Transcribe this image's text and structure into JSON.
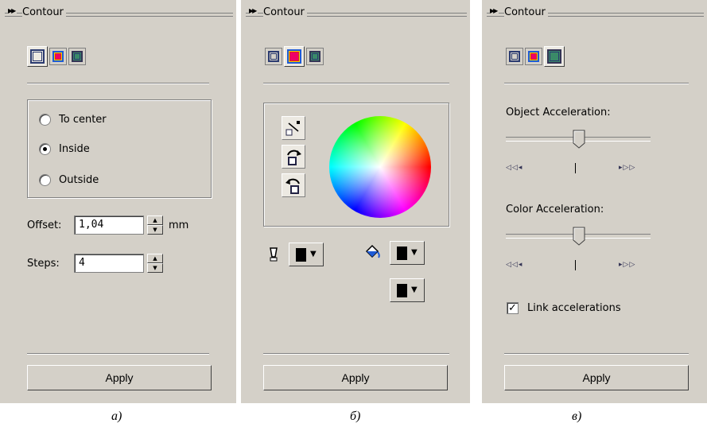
{
  "panels": [
    {
      "title": "Contour",
      "caption": "а)"
    },
    {
      "title": "Contour",
      "caption": "б)"
    },
    {
      "title": "Contour",
      "caption": "в)"
    }
  ],
  "panel_a": {
    "options": [
      {
        "label": "To center",
        "selected": false
      },
      {
        "label": "Inside",
        "selected": true
      },
      {
        "label": "Outside",
        "selected": false
      }
    ],
    "offset_label": "Offset:",
    "offset_value": "1,04",
    "offset_unit": "mm",
    "steps_label": "Steps:",
    "steps_value": "4",
    "apply_label": "Apply"
  },
  "panel_b": {
    "apply_label": "Apply",
    "outline_color": "#000000",
    "fill_color": "#000000",
    "fill_color2": "#000000"
  },
  "panel_c": {
    "object_accel_label": "Object Acceleration:",
    "color_accel_label": "Color Acceleration:",
    "object_accel_level": 0.5,
    "color_accel_level": 0.5,
    "link_label": "Link accelerations",
    "link_checked": true,
    "apply_label": "Apply"
  },
  "icons": {
    "panel_arrow": "double-right-arrow-icon",
    "tab_to_center": "contour-to-center-icon",
    "tab_inside": "contour-inside-icon",
    "tab_outside": "contour-outside-icon"
  },
  "colors": {
    "panel_bg": "#d4d0c8"
  }
}
